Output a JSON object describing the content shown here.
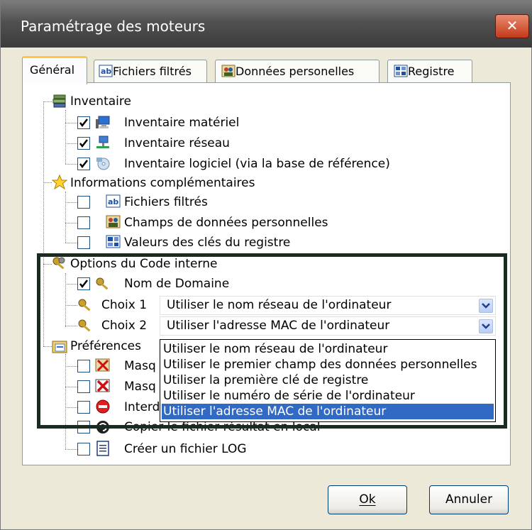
{
  "window": {
    "title": "Paramétrage des moteurs",
    "close_label": "✕"
  },
  "tabs": [
    {
      "label": "Général"
    },
    {
      "label": "Fichiers filtrés"
    },
    {
      "label": "Données personelles"
    },
    {
      "label": "Registre"
    }
  ],
  "tree": {
    "inventaire": {
      "label": "Inventaire",
      "items": [
        {
          "label": "Inventaire matériel",
          "checked": true
        },
        {
          "label": "Inventaire réseau",
          "checked": true
        },
        {
          "label": "Inventaire logiciel (via la base de référence)",
          "checked": true
        }
      ]
    },
    "infos": {
      "label": "Informations complémentaires",
      "items": [
        {
          "label": "Fichiers filtrés",
          "checked": false
        },
        {
          "label": "Champs de données personnelles",
          "checked": false
        },
        {
          "label": "Valeurs des clés du registre",
          "checked": false
        }
      ]
    },
    "options": {
      "label": "Options du Code interne",
      "nom_domaine": {
        "label": "Nom de Domaine",
        "checked": true
      },
      "choix1": {
        "label": "Choix 1",
        "value": "Utiliser le nom réseau de l'ordinateur"
      },
      "choix2": {
        "label": "Choix 2",
        "value": "Utiliser l'adresse MAC de l'ordinateur"
      }
    },
    "preferences": {
      "label": "Préférences",
      "items": [
        {
          "label": "Masq"
        },
        {
          "label": "Masq"
        },
        {
          "label": "Interd"
        },
        {
          "label": "Copier le fichier résultat en local"
        },
        {
          "label": "Créer un fichier LOG"
        }
      ]
    }
  },
  "dropdown_options": [
    "Utiliser le nom réseau de l'ordinateur",
    "Utiliser le premier champ des données personnelles",
    "Utiliser la première clé de registre",
    "Utiliser le numéro de série de l'ordinateur",
    "Utiliser l'adresse MAC de l'ordinateur"
  ],
  "dropdown_selected": "Utiliser l'adresse MAC de l'ordinateur",
  "buttons": {
    "ok": "Ok",
    "cancel": "Annuler"
  }
}
